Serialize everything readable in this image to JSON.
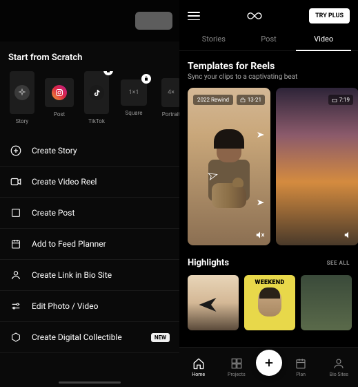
{
  "left": {
    "scratch_title": "Start from Scratch",
    "formats": [
      {
        "label": "Story",
        "icon": "sparkle"
      },
      {
        "label": "Post",
        "icon": "instagram"
      },
      {
        "label": "TikTok",
        "icon": "tiktok",
        "locked": true
      },
      {
        "label": "Square",
        "ratio": "1×1",
        "locked": true
      },
      {
        "label": "Portrait",
        "ratio": "4×"
      }
    ],
    "actions": [
      {
        "label": "Create Story",
        "icon": "plus-circle"
      },
      {
        "label": "Create Video Reel",
        "icon": "video"
      },
      {
        "label": "Create Post",
        "icon": "square"
      },
      {
        "label": "Add to Feed Planner",
        "icon": "calendar"
      },
      {
        "label": "Create Link in Bio Site",
        "icon": "person"
      },
      {
        "label": "Edit Photo / Video",
        "icon": "sliders"
      },
      {
        "label": "Create Digital Collectible",
        "icon": "hexagon",
        "badge": "NEW"
      }
    ]
  },
  "right": {
    "try_plus": "TRY PLUS",
    "tabs": [
      {
        "label": "Stories"
      },
      {
        "label": "Post"
      },
      {
        "label": "Video",
        "active": true
      }
    ],
    "templates": {
      "title": "Templates for Reels",
      "subtitle": "Sync your clips to a captivating beat"
    },
    "reels": [
      {
        "tag": "2022 Rewind",
        "duration": "13-21"
      },
      {
        "tag": "",
        "duration": "7:19"
      }
    ],
    "highlights": {
      "title": "Highlights",
      "see_all": "SEE ALL",
      "weekend": "WEEKEND"
    },
    "nav": [
      {
        "label": "Home",
        "icon": "home",
        "active": true
      },
      {
        "label": "Projects",
        "icon": "grid"
      },
      {
        "label": "",
        "icon": "plus",
        "fab": true
      },
      {
        "label": "Plan",
        "icon": "calendar"
      },
      {
        "label": "Bio Sites",
        "icon": "person"
      }
    ]
  }
}
